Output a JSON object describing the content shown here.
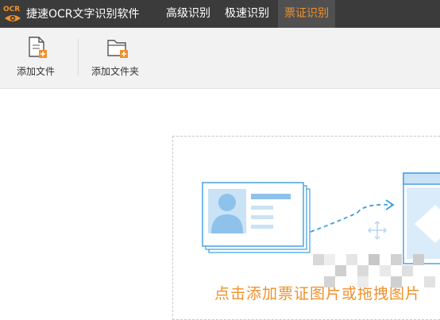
{
  "app": {
    "logo_text": "OCR",
    "title": "捷速OCR文字识别软件"
  },
  "nav": {
    "items": [
      {
        "label": "高级识别"
      },
      {
        "label": "极速识别"
      },
      {
        "label": "票证识别"
      }
    ]
  },
  "toolbar": {
    "add_file_label": "添加文件",
    "add_folder_label": "添加文件夹"
  },
  "main": {
    "drop_hint": "点击添加票证图片或拖拽图片"
  },
  "colors": {
    "titlebar": "#3b3b3b",
    "accent": "#f0902a",
    "illustration_blue": "#3d9de0"
  },
  "icons": {
    "logo": "ocr-eye-logo",
    "add_file": "add-file-icon",
    "add_folder": "add-folder-icon",
    "id_card": "id-card-icon",
    "arrow": "dashed-arrow-icon",
    "move": "move-icon"
  }
}
